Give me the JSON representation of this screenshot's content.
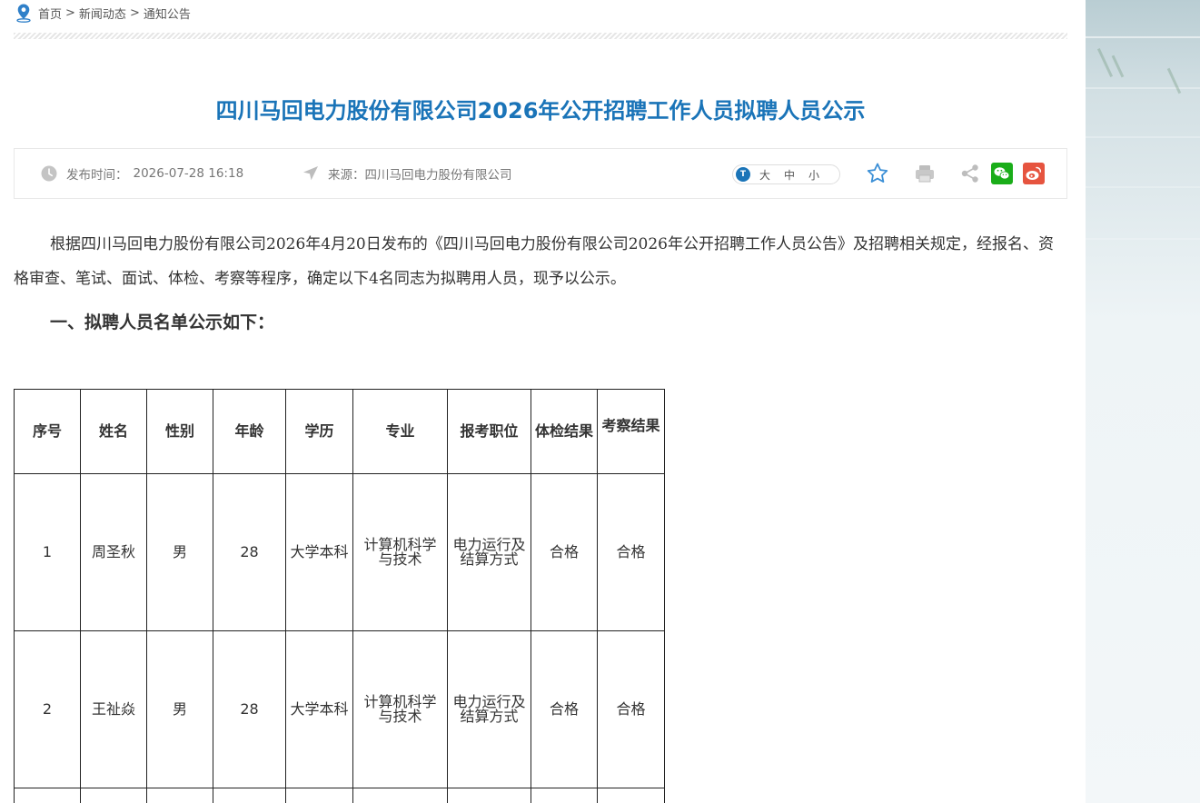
{
  "breadcrumb": {
    "items": [
      "首页",
      "新闻动态",
      "通知公告"
    ],
    "separator": ">"
  },
  "article": {
    "title": "四川马回电力股份有限公司2026年公开招聘工作人员拟聘人员公示",
    "publish_label": "发布时间：",
    "publish_time": "2026-07-28 16:18",
    "source_label": "来源：",
    "source": "四川马回电力股份有限公司",
    "font_size_options": [
      "大",
      "中",
      "小"
    ],
    "paragraph_1": "根据四川马回电力股份有限公司2026年4月20日发布的《四川马回电力股份有限公司2026年公开招聘工作人员公告》及招聘相关规定，经报名、资格审查、笔试、面试、体检、考察等程序，确定以下4名同志为拟聘用人员，现予以公示。",
    "section_heading": "一、拟聘人员名单公示如下："
  },
  "icons": {
    "location": "location-pin-icon",
    "clock": "clock-icon",
    "source": "navigation-arrow-icon",
    "favorite": "star-icon",
    "print": "printer-icon",
    "share": "share-icon",
    "wechat": "wechat-icon",
    "weibo": "weibo-icon"
  },
  "colors": {
    "title": "#1a74b8",
    "wechat": "#1aad19",
    "weibo": "#e6543f",
    "star": "#3b8fd6"
  },
  "table": {
    "headers": [
      "序号",
      "姓名",
      "性别",
      "年龄",
      "学历",
      "专业",
      "报考职位",
      "体检结果",
      "考察结果"
    ],
    "rows": [
      [
        "1",
        "周圣秋",
        "男",
        "28",
        "大学本科",
        "计算机科学与技术",
        "电力运行及结算方式",
        "合格",
        "合格"
      ],
      [
        "2",
        "王祉焱",
        "男",
        "28",
        "大学本科",
        "计算机科学与技术",
        "电力运行及结算方式",
        "合格",
        "合格"
      ]
    ]
  }
}
